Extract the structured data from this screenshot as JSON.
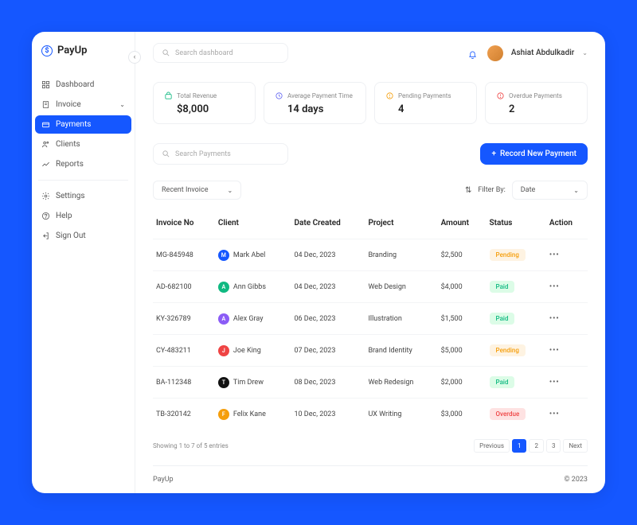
{
  "brand": "PayUp",
  "sidebar": {
    "items": [
      {
        "label": "Dashboard"
      },
      {
        "label": "Invoice"
      },
      {
        "label": "Payments"
      },
      {
        "label": "Clients"
      },
      {
        "label": "Reports"
      }
    ],
    "secondary": [
      {
        "label": "Settings"
      },
      {
        "label": "Help"
      },
      {
        "label": "Sign Out"
      }
    ]
  },
  "topbar": {
    "search_placeholder": "Search dashboard",
    "user_name": "Ashiat Abdulkadir"
  },
  "stats": [
    {
      "label": "Total Revenue",
      "value": "$8,000"
    },
    {
      "label": "Average Payment Time",
      "value": "14 days"
    },
    {
      "label": "Pending Payments",
      "value": "4"
    },
    {
      "label": "Overdue Payments",
      "value": "2"
    }
  ],
  "payments": {
    "search_placeholder": "Search Payments",
    "record_button": "Record New Payment",
    "sort_dropdown": "Recent Invoice",
    "filter_label": "Filter By:",
    "filter_value": "Date",
    "columns": [
      "Invoice No",
      "Client",
      "Date Created",
      "Project",
      "Amount",
      "Status",
      "Action"
    ],
    "rows": [
      {
        "invoice": "MG-845948",
        "client_initial": "M",
        "client_color": "#1557ff",
        "client": "Mark Abel",
        "date": "04 Dec, 2023",
        "project": "Branding",
        "amount": "$2,500",
        "status": "Pending",
        "status_class": "pending"
      },
      {
        "invoice": "AD-682100",
        "client_initial": "A",
        "client_color": "#10b981",
        "client": "Ann Gibbs",
        "date": "04 Dec, 2023",
        "project": "Web Design",
        "amount": "$4,000",
        "status": "Paid",
        "status_class": "paid"
      },
      {
        "invoice": "KY-326789",
        "client_initial": "A",
        "client_color": "#8b5cf6",
        "client": "Alex Gray",
        "date": "06 Dec, 2023",
        "project": "Illustration",
        "amount": "$1,500",
        "status": "Paid",
        "status_class": "paid"
      },
      {
        "invoice": "CY-483211",
        "client_initial": "J",
        "client_color": "#ef4444",
        "client": "Joe King",
        "date": "07 Dec, 2023",
        "project": "Brand Identity",
        "amount": "$5,000",
        "status": "Pending",
        "status_class": "pending"
      },
      {
        "invoice": "BA-112348",
        "client_initial": "T",
        "client_color": "#111111",
        "client": "Tim Drew",
        "date": "08 Dec, 2023",
        "project": "Web Redesign",
        "amount": "$2,000",
        "status": "Paid",
        "status_class": "paid"
      },
      {
        "invoice": "TB-320142",
        "client_initial": "F",
        "client_color": "#f59e0b",
        "client": "Felix Kane",
        "date": "10 Dec, 2023",
        "project": "UX Writing",
        "amount": "$3,000",
        "status": "Overdue",
        "status_class": "overdue"
      }
    ],
    "showing": "Showing 1 to 7 of 5 entries",
    "pagination": {
      "prev": "Previous",
      "pages": [
        "1",
        "2",
        "3"
      ],
      "next": "Next"
    }
  },
  "footer": {
    "brand": "PayUp",
    "copy": "© 2023"
  }
}
